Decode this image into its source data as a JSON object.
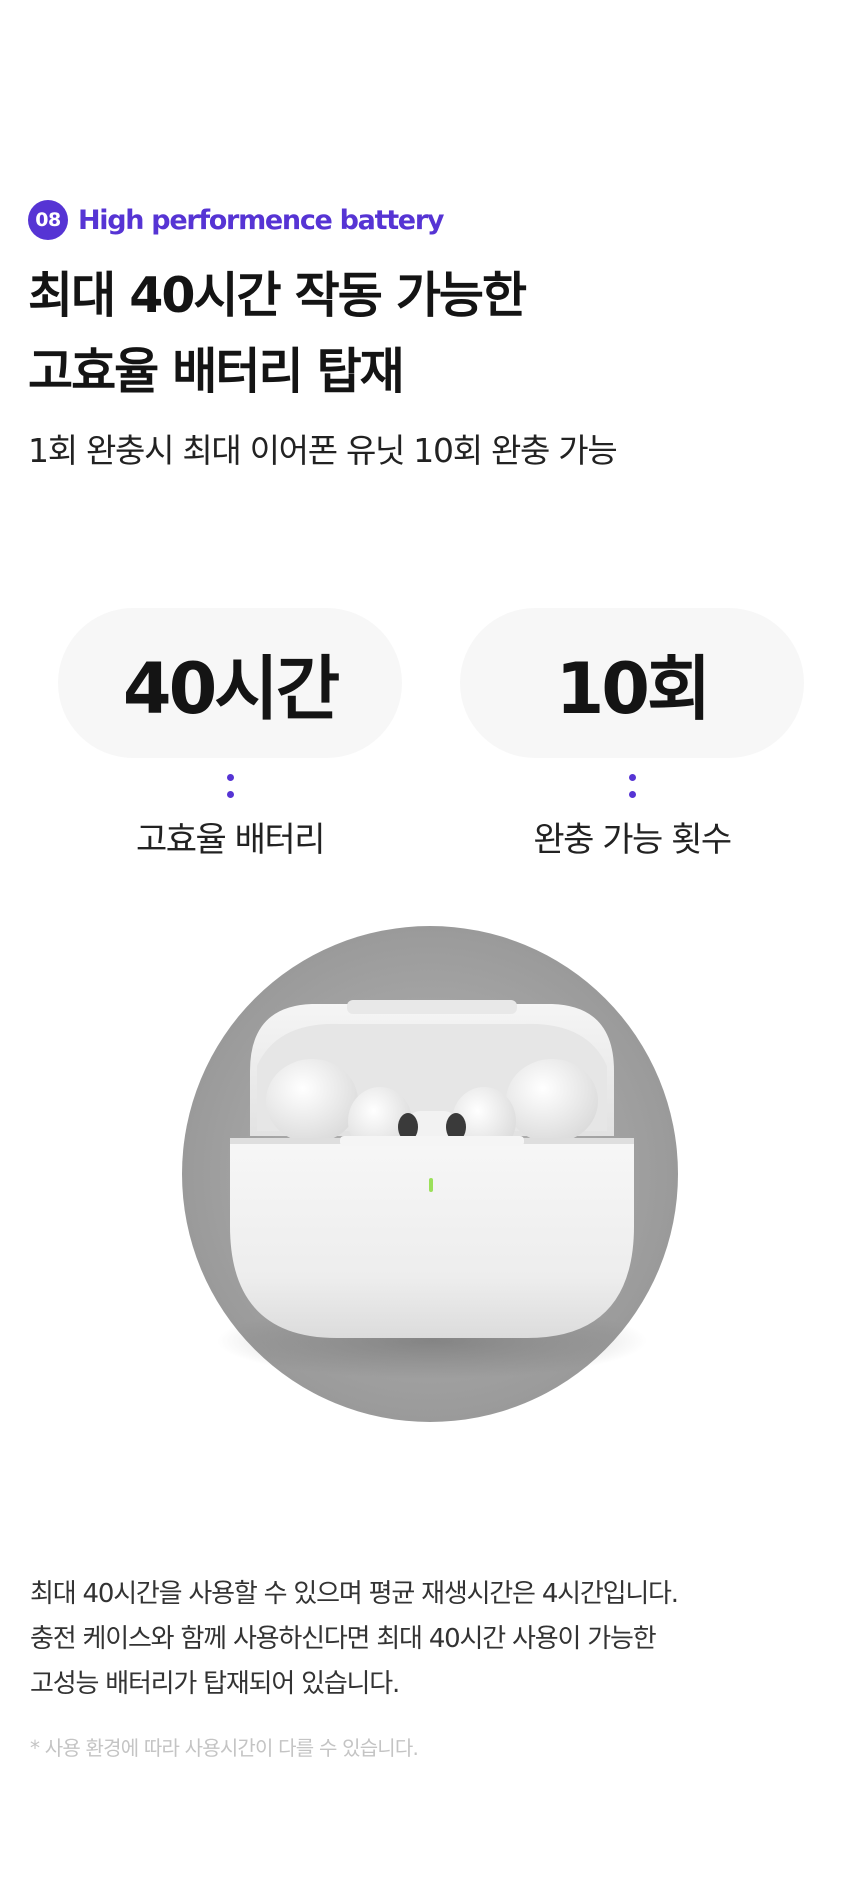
{
  "badge": {
    "number": "08",
    "label": "High performence battery"
  },
  "title": {
    "line1": "최대 40시간 작동 가능한",
    "line2": "고효율 배터리 탑재"
  },
  "subtitle": "1회 완충시 최대 이어폰 유닛 10회 완충 가능",
  "stats": [
    {
      "value": "40시간",
      "caption": "고효율 배터리"
    },
    {
      "value": "10회",
      "caption": "완충 가능 횟수"
    }
  ],
  "product": {
    "icon": "earbuds-charging-case-image",
    "colors": {
      "circle": "#a3a3a3",
      "case": "#f2f2f2",
      "led": "#9be05a"
    }
  },
  "description": {
    "line1": "최대 40시간을 사용할 수 있으며 평균 재생시간은 4시간입니다.",
    "line2": "충전 케이스와 함께 사용하신다면 최대 40시간 사용이 가능한",
    "line3": "고성능 배터리가 탑재되어 있습니다."
  },
  "note": "* 사용 환경에 따라 사용시간이 다를 수 있습니다.",
  "colors": {
    "accent": "#5634d4",
    "pill_background": "#f7f7f7",
    "note_text": "#c4c4c4"
  }
}
